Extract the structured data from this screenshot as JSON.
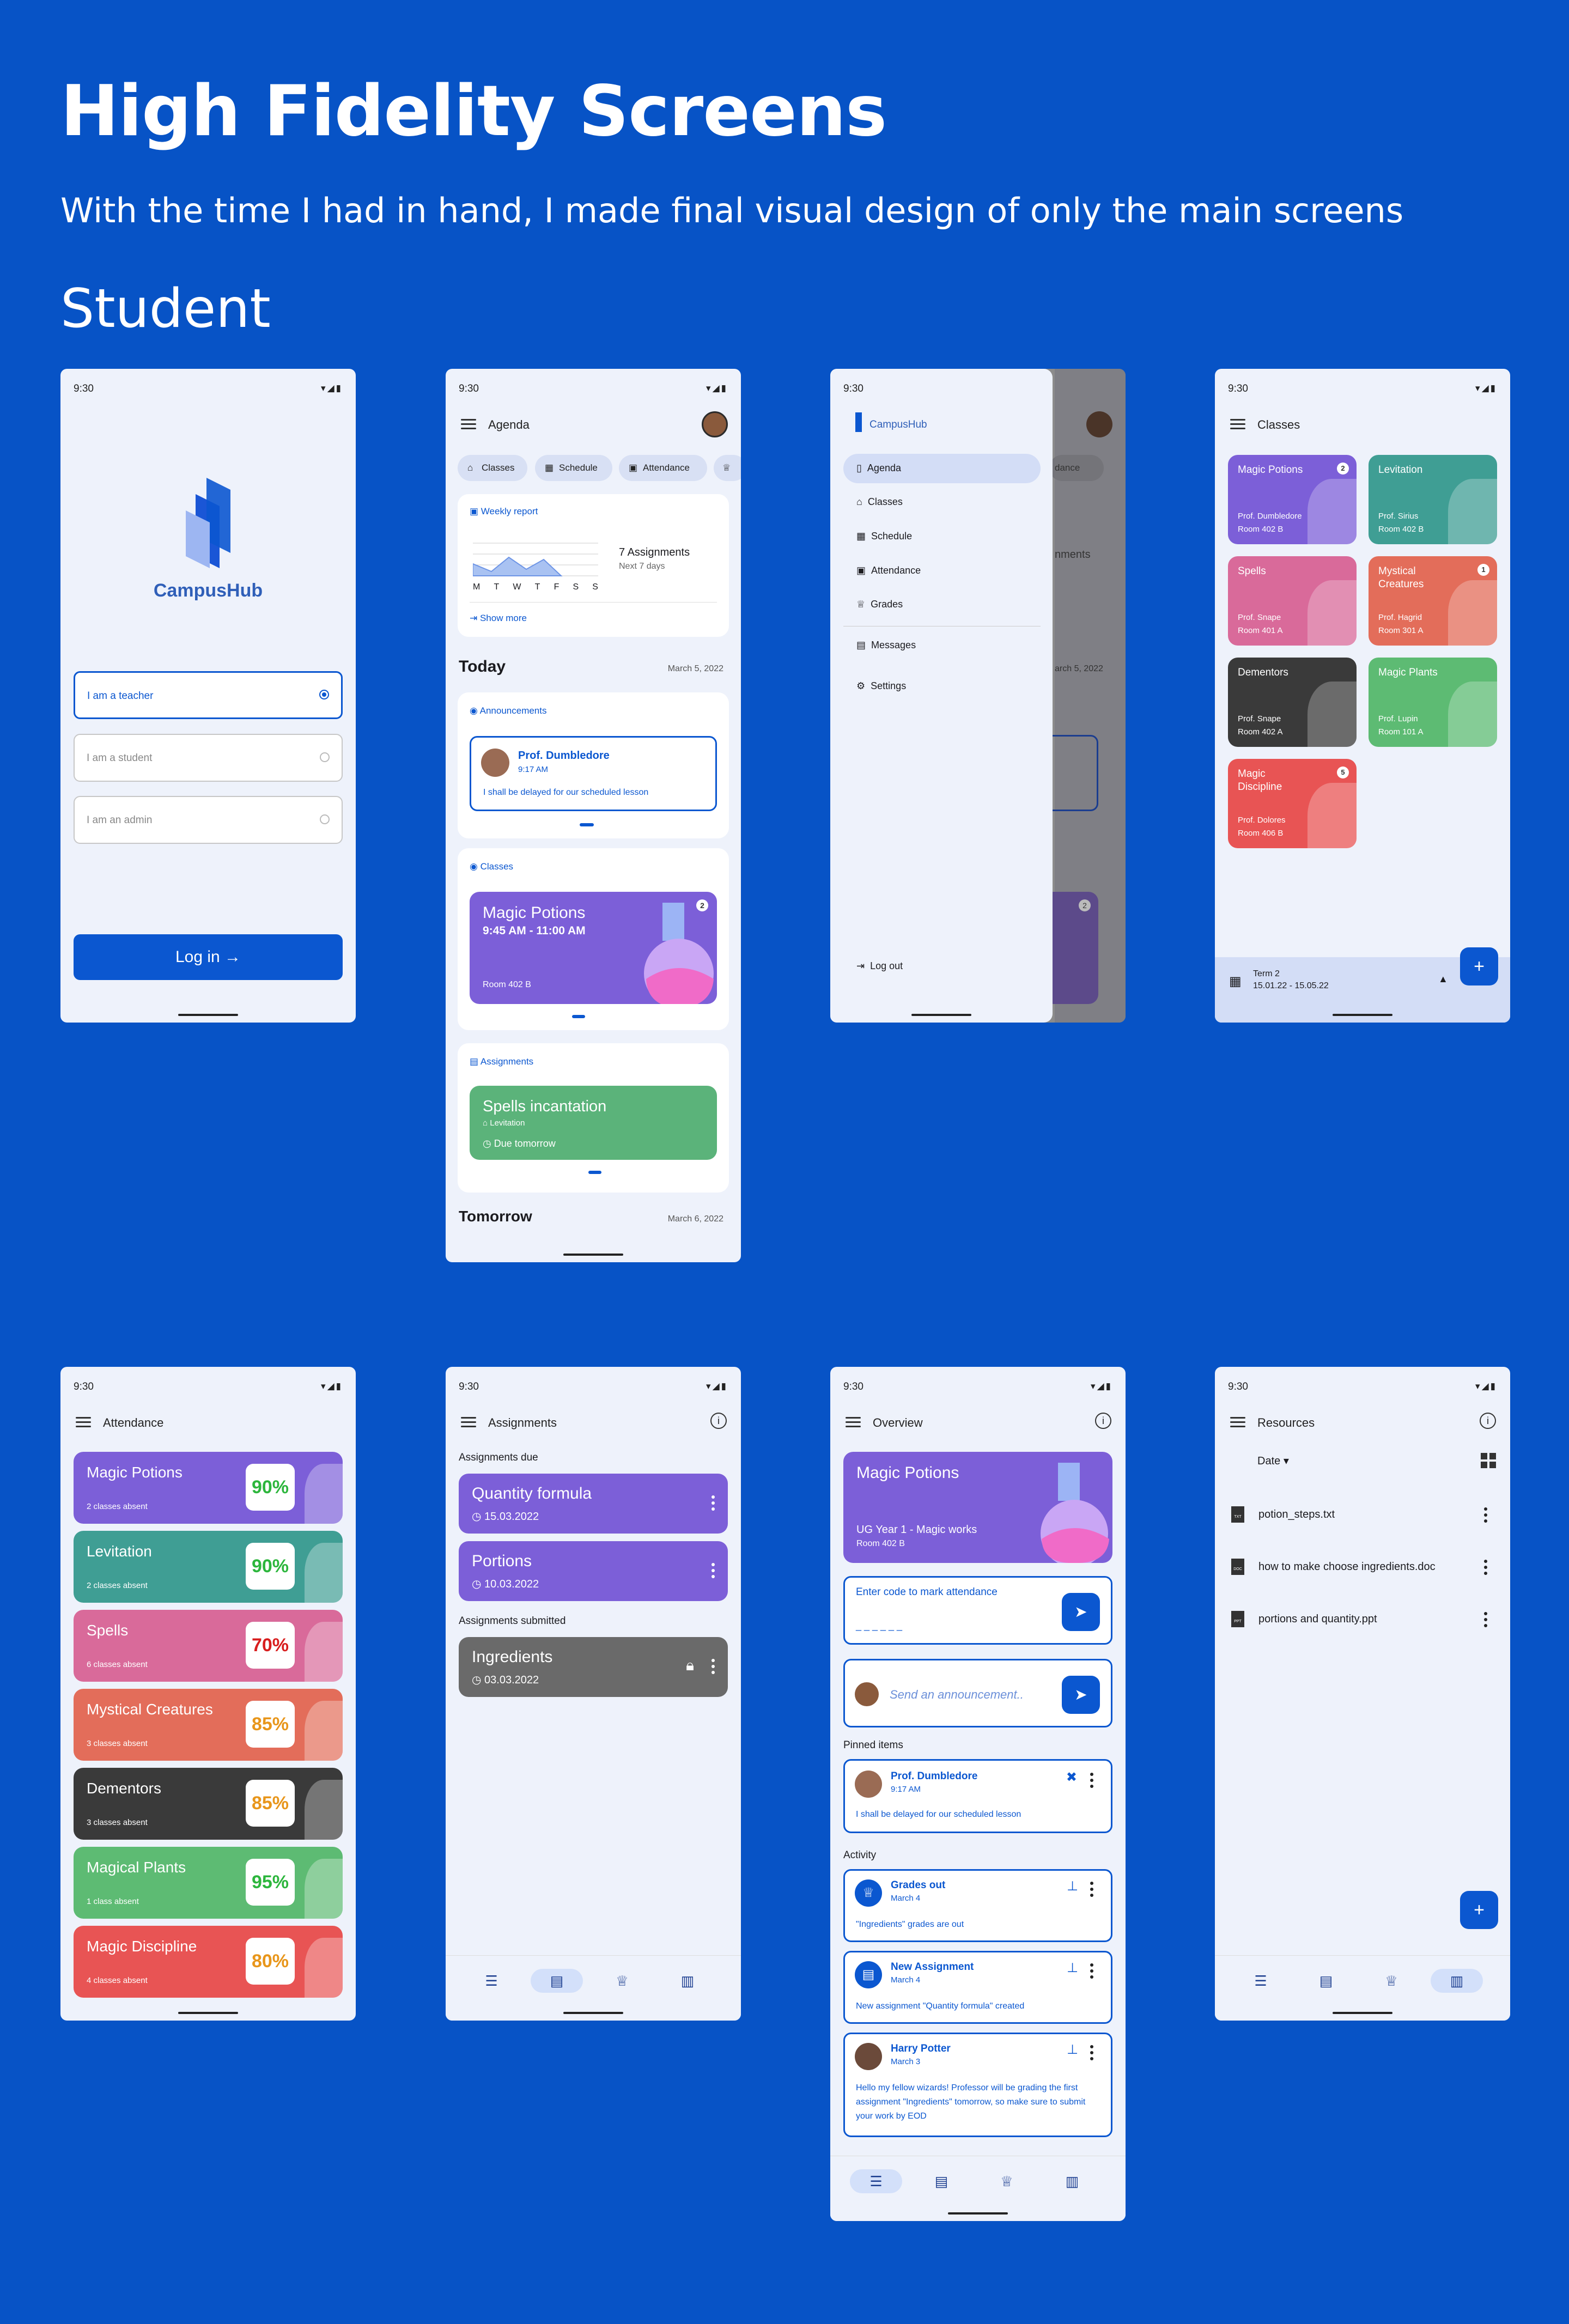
{
  "header": {
    "title": "High Fidelity Screens",
    "subtitle": "With the time I had in hand, I made final visual design of only the main screens",
    "section": "Student"
  },
  "status": {
    "time": "9:30"
  },
  "login": {
    "brand": "CampusHub",
    "options": [
      "I am a teacher",
      "I am a student",
      "I am an admin"
    ],
    "login_button": "Log in"
  },
  "agenda": {
    "title": "Agenda",
    "chips": [
      "Classes",
      "Schedule",
      "Attendance"
    ],
    "weekly_title": "Weekly report",
    "days": [
      "M",
      "T",
      "W",
      "T",
      "F",
      "S",
      "S"
    ],
    "assign_count": "7 Assignments",
    "assign_range": "Next 7 days",
    "show_more": "Show more",
    "today": "Today",
    "today_date": "March 5, 2022",
    "ann_title": "Announcements",
    "ann_author": "Prof. Dumbledore",
    "ann_time": "9:17 AM",
    "ann_text": "I shall be delayed for our scheduled lesson",
    "classes_title": "Classes",
    "class_name": "Magic Potions",
    "class_time": "9:45 AM - 11:00 AM",
    "class_room": "Room 402 B",
    "class_badge": "2",
    "assign_title": "Assignments",
    "assignment": "Spells incantation",
    "assignment_sub": "Levitation",
    "assignment_due": "Due tomorrow",
    "tomorrow": "Tomorrow",
    "tomorrow_date": "March 6, 2022"
  },
  "drawer": {
    "brand": "CampusHub",
    "items": [
      "Agenda",
      "Classes",
      "Schedule",
      "Attendance",
      "Grades",
      "Messages",
      "Settings"
    ],
    "logout": "Log out",
    "bg_frag_1": "dance",
    "bg_frag_2": "nments",
    "bg_frag_3": "arch 5, 2022",
    "bg_badge": "2"
  },
  "classes": {
    "title": "Classes",
    "cards": [
      {
        "name": "Magic Potions",
        "prof": "Prof. Dumbledore",
        "room": "Room 402 B",
        "badge": "2",
        "color": "#7C5FD8"
      },
      {
        "name": "Levitation",
        "prof": "Prof. Sirius",
        "room": "Room 402 B",
        "badge": "",
        "color": "#3F9E94"
      },
      {
        "name": "Spells",
        "prof": "Prof. Snape",
        "room": "Room 401 A",
        "badge": "",
        "color": "#D96A9A"
      },
      {
        "name": "Mystical Creatures",
        "prof": "Prof. Hagrid",
        "room": "Room 301 A",
        "badge": "1",
        "color": "#E36D5A"
      },
      {
        "name": "Dementors",
        "prof": "Prof. Snape",
        "room": "Room 402 A",
        "badge": "",
        "color": "#3A3A3A"
      },
      {
        "name": "Magic Plants",
        "prof": "Prof. Lupin",
        "room": "Room 101 A",
        "badge": "",
        "color": "#5DBB73"
      },
      {
        "name": "Magic Discipline",
        "prof": "Prof. Dolores",
        "room": "Room 406 B",
        "badge": "5",
        "color": "#E85454"
      }
    ],
    "term": "Term 2",
    "term_dates": "15.01.22 - 15.05.22"
  },
  "attendance": {
    "title": "Attendance",
    "rows": [
      {
        "name": "Magic Potions",
        "absent": "2 classes absent",
        "pct": "90%",
        "color": "#7C5FD8",
        "pct_color": "#2DB63D"
      },
      {
        "name": "Levitation",
        "absent": "2 classes absent",
        "pct": "90%",
        "color": "#3F9E94",
        "pct_color": "#2DB63D"
      },
      {
        "name": "Spells",
        "absent": "6 classes absent",
        "pct": "70%",
        "color": "#D96A9A",
        "pct_color": "#D81E1E"
      },
      {
        "name": "Mystical Creatures",
        "absent": "3 classes absent",
        "pct": "85%",
        "color": "#E36D5A",
        "pct_color": "#E8961B"
      },
      {
        "name": "Dementors",
        "absent": "3 classes absent",
        "pct": "85%",
        "color": "#3A3A3A",
        "pct_color": "#E8961B"
      },
      {
        "name": "Magical Plants",
        "absent": "1 class absent",
        "pct": "95%",
        "color": "#5DBB73",
        "pct_color": "#2DB63D"
      },
      {
        "name": "Magic Discipline",
        "absent": "4 classes absent",
        "pct": "80%",
        "color": "#E85454",
        "pct_color": "#E8961B"
      }
    ]
  },
  "assignments": {
    "title": "Assignments",
    "due_label": "Assignments due",
    "submitted_label": "Assignments submitted",
    "due": [
      {
        "name": "Quantity formula",
        "date": "15.03.2022"
      },
      {
        "name": "Portions",
        "date": "10.03.2022"
      }
    ],
    "submitted": [
      {
        "name": "Ingredients",
        "date": "03.03.2022"
      }
    ]
  },
  "overview": {
    "title": "Overview",
    "class_name": "Magic Potions",
    "class_sub": "UG Year 1 - Magic works",
    "class_room": "Room 402 B",
    "code_label": "Enter code to mark attendance",
    "code_placeholder": "_ _ _ _ _ _",
    "announce_placeholder": "Send an announcement..",
    "pinned_label": "Pinned items",
    "pinned_author": "Prof. Dumbledore",
    "pinned_time": "9:17 AM",
    "pinned_text": "I shall be delayed for our scheduled lesson",
    "activity_label": "Activity",
    "activity": [
      {
        "title": "Grades out",
        "date": "March 4",
        "text": "\"Ingredients\" grades are out"
      },
      {
        "title": "New Assignment",
        "date": "March 4",
        "text": "New assignment \"Quantity formula\" created"
      },
      {
        "title": "Harry Potter",
        "date": "March 3",
        "text": "Hello my fellow wizards! Professor will be grading the first assignment \"Ingredients\" tomorrow, so make sure to submit your work by EOD"
      }
    ]
  },
  "resources": {
    "title": "Resources",
    "sort": "Date",
    "files": [
      "potion_steps.txt",
      "how to make choose ingredients.doc",
      "portions and quantity.ppt"
    ],
    "file_types": [
      "TXT",
      "DOC",
      "PPT"
    ]
  },
  "colors": {
    "bg": "#0753C6",
    "primary": "#0B57D0",
    "screen": "#EEF2FB"
  }
}
